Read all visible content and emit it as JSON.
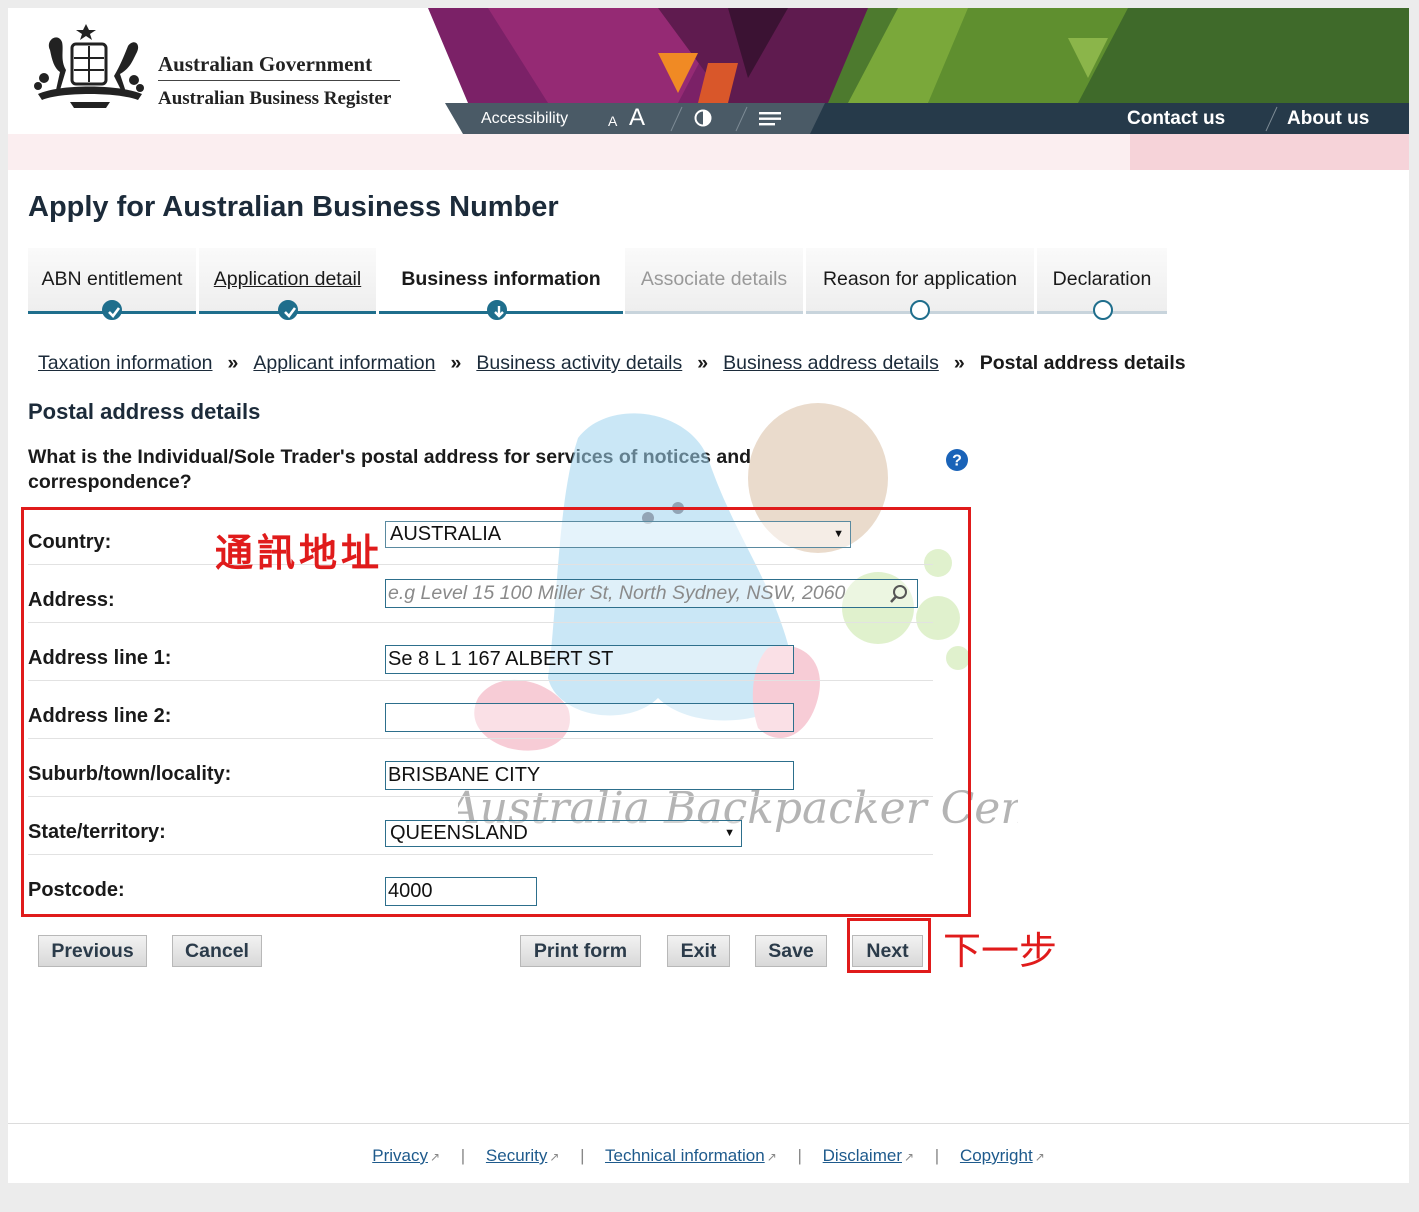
{
  "header": {
    "gov_name": "Australian Government",
    "abr_name": "Australian Business Register",
    "accessibility_label": "Accessibility",
    "font_small": "A",
    "font_large": "A",
    "contact_label": "Contact us",
    "about_label": "About us"
  },
  "page_title": "Apply for Australian Business Number",
  "steps": [
    {
      "label": "ABN entitlement",
      "state": "done"
    },
    {
      "label": "Application detail",
      "state": "done"
    },
    {
      "label": "Business information",
      "state": "current"
    },
    {
      "label": "Associate details",
      "state": "disabled"
    },
    {
      "label": "Reason for application",
      "state": "todo"
    },
    {
      "label": "Declaration",
      "state": "todo"
    }
  ],
  "breadcrumb": {
    "items": [
      "Taxation information",
      "Applicant information",
      "Business activity details",
      "Business address details"
    ],
    "separator": "»",
    "current": "Postal address details"
  },
  "section_title": "Postal address details",
  "question": "What is the Individual/Sole Trader's postal address for services of notices and correspondence?",
  "form": {
    "country": {
      "label": "Country:",
      "value": "AUSTRALIA"
    },
    "address": {
      "label": "Address:",
      "placeholder": "e.g Level 15 100 Miller St, North Sydney, NSW, 2060"
    },
    "address_line1": {
      "label": "Address line 1:",
      "value": "Se 8  L 1  167 ALBERT ST"
    },
    "address_line2": {
      "label": "Address line 2:",
      "value": ""
    },
    "suburb": {
      "label": "Suburb/town/locality:",
      "value": "BRISBANE CITY"
    },
    "state": {
      "label": "State/territory:",
      "value": "QUEENSLAND"
    },
    "postcode": {
      "label": "Postcode:",
      "value": "4000"
    }
  },
  "annotations": {
    "form_label": "通訊地址",
    "next_label": "下一步"
  },
  "watermark_text": "Australia Backpacker Center",
  "buttons": {
    "previous": "Previous",
    "cancel": "Cancel",
    "print": "Print form",
    "exit": "Exit",
    "save": "Save",
    "next": "Next"
  },
  "footer": {
    "links": [
      "Privacy",
      "Security",
      "Technical information",
      "Disclaimer",
      "Copyright"
    ]
  },
  "colors": {
    "accent": "#1f6e8c",
    "annotation_red": "#e01b1b",
    "navbar": "#263a4a"
  },
  "icons": [
    "crest-logo",
    "contrast-icon",
    "menu-icon",
    "check-icon",
    "help-icon",
    "search-icon",
    "external-link-icon"
  ]
}
